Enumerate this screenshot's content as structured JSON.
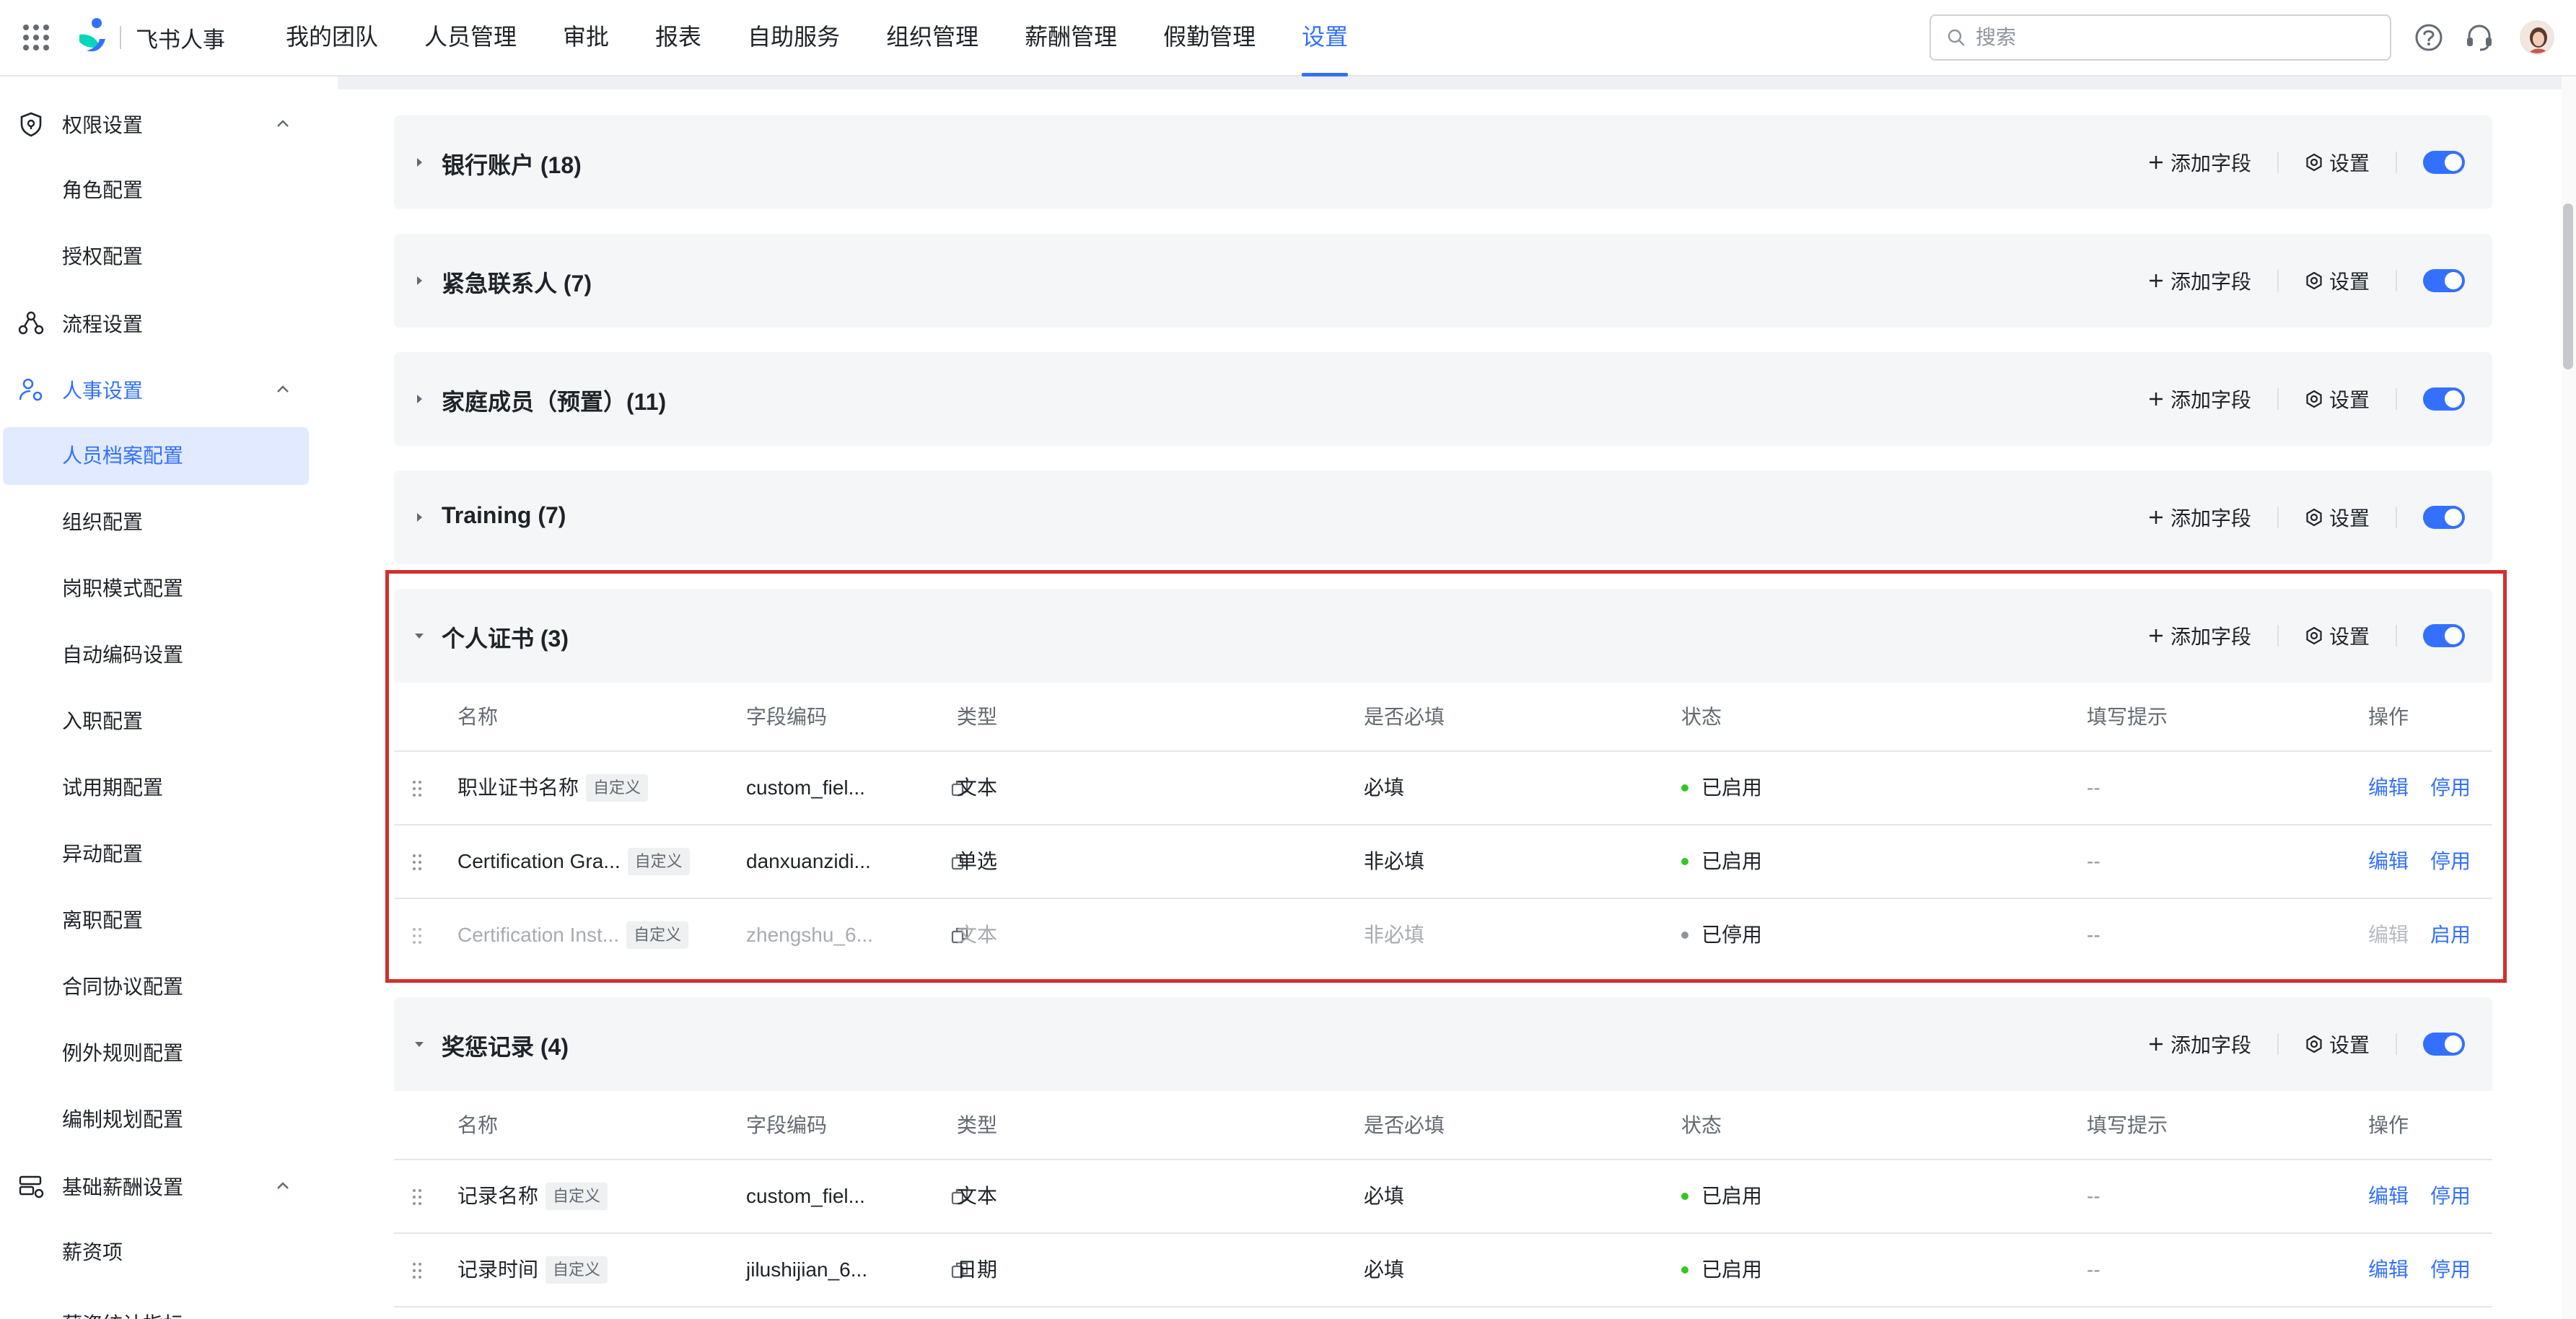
{
  "app": {
    "name": "飞书人事"
  },
  "nav": [
    "我的团队",
    "人员管理",
    "审批",
    "报表",
    "自助服务",
    "组织管理",
    "薪酬管理",
    "假勤管理",
    "设置"
  ],
  "search": {
    "placeholder": "搜索"
  },
  "sidebar": {
    "groups": [
      {
        "label": "权限设置",
        "icon": "shield-icon",
        "items": [
          "角色配置",
          "授权配置"
        ]
      },
      {
        "label": "流程设置",
        "icon": "workflow-icon",
        "items": []
      },
      {
        "label": "人事设置",
        "icon": "user-settings-icon",
        "items": [
          "人员档案配置",
          "组织配置",
          "岗职模式配置",
          "自动编码设置",
          "入职配置",
          "试用期配置",
          "异动配置",
          "离职配置",
          "合同协议配置",
          "例外规则配置",
          "编制规划配置"
        ]
      },
      {
        "label": "基础薪酬设置",
        "icon": "salary-settings-icon",
        "items": [
          "薪资项",
          "薪资统计指标"
        ]
      }
    ],
    "active_item": "人员档案配置"
  },
  "actions": {
    "add_field": "添加字段",
    "settings": "设置"
  },
  "columns": [
    "名称",
    "字段编码",
    "类型",
    "是否必填",
    "状态",
    "填写提示",
    "操作"
  ],
  "sections": [
    {
      "title": "银行账户 (18)",
      "expanded": false,
      "enabled": true
    },
    {
      "title": "紧急联系人 (7)",
      "expanded": false,
      "enabled": true
    },
    {
      "title": "家庭成员（预置）(11)",
      "expanded": false,
      "enabled": true
    },
    {
      "title": "Training (7)",
      "expanded": false,
      "enabled": true
    },
    {
      "title": "个人证书 (3)",
      "expanded": true,
      "enabled": true,
      "rows": [
        {
          "name": "职业证书名称",
          "tag": "自定义",
          "code": "custom_fiel...",
          "type": "文本",
          "required": "必填",
          "status": "已启用",
          "hint": "--",
          "edit": "编辑",
          "toggle_action": "停用",
          "disabled": false
        },
        {
          "name": "Certification Gra...",
          "tag": "自定义",
          "code": "danxuanzidi...",
          "type": "单选",
          "required": "非必填",
          "status": "已启用",
          "hint": "--",
          "edit": "编辑",
          "toggle_action": "停用",
          "disabled": false
        },
        {
          "name": "Certification Inst...",
          "tag": "自定义",
          "code": "zhengshu_6...",
          "type": "文本",
          "required": "非必填",
          "status": "已停用",
          "hint": "--",
          "edit": "编辑",
          "toggle_action": "启用",
          "disabled": true
        }
      ]
    },
    {
      "title": "奖惩记录 (4)",
      "expanded": true,
      "enabled": true,
      "rows": [
        {
          "name": "记录名称",
          "tag": "自定义",
          "code": "custom_fiel...",
          "type": "文本",
          "required": "必填",
          "status": "已启用",
          "hint": "--",
          "edit": "编辑",
          "toggle_action": "停用",
          "disabled": false
        },
        {
          "name": "记录时间",
          "tag": "自定义",
          "code": "jilushijian_6...",
          "type": "日期",
          "required": "必填",
          "status": "已启用",
          "hint": "--",
          "edit": "编辑",
          "toggle_action": "停用",
          "disabled": false
        }
      ]
    }
  ],
  "colors": {
    "accent": "#3370ff",
    "status_enabled": "#34c724",
    "status_disabled": "#8f959e",
    "highlight": "#d0302f"
  }
}
